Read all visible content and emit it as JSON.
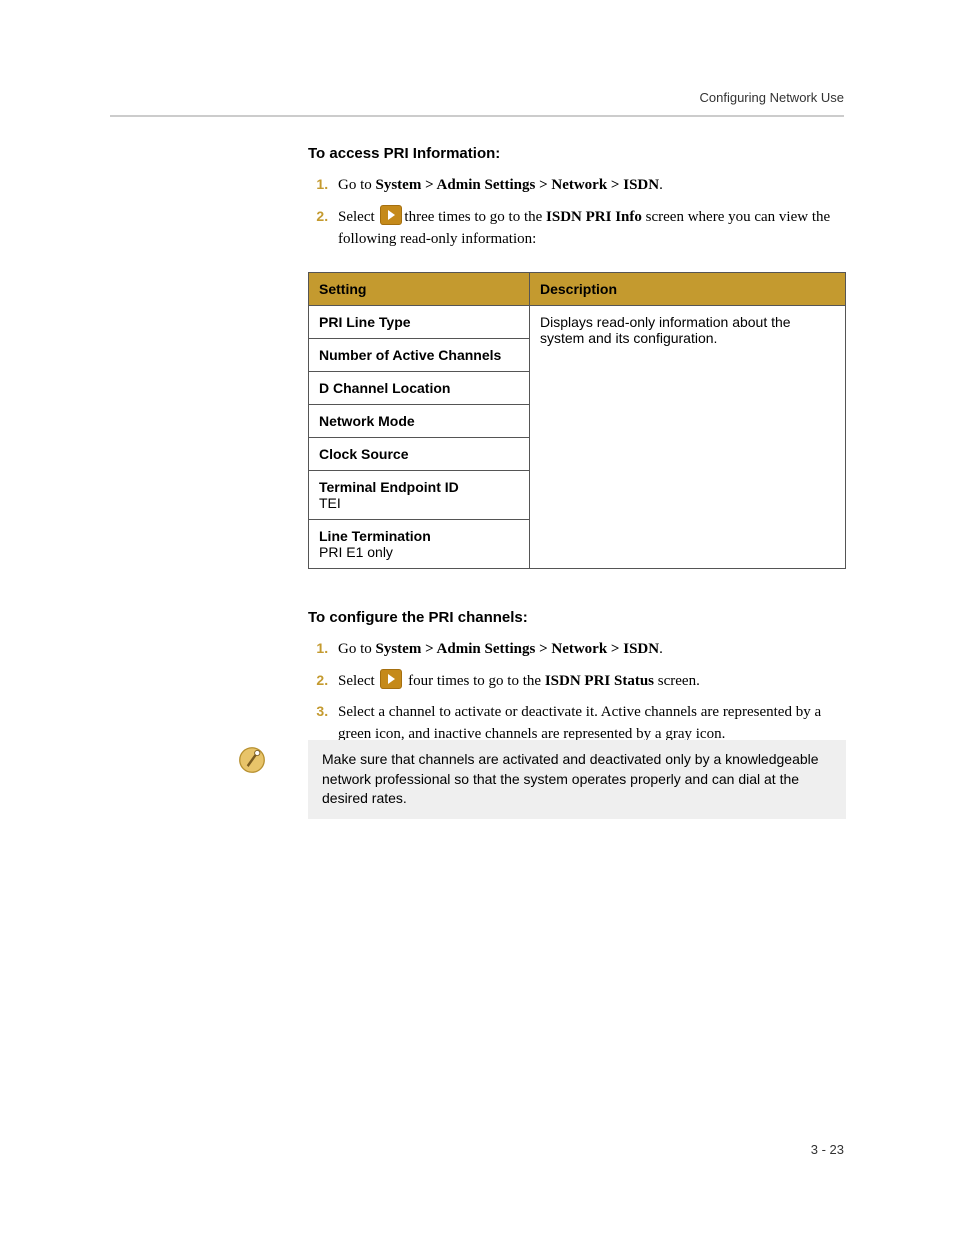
{
  "header": {
    "section_title": "Configuring Network Use"
  },
  "section1": {
    "heading": "To access PRI Information:",
    "steps": [
      {
        "prefix": "Go to ",
        "nav_path": "System > Admin Settings > Network > ISDN",
        "suffix": "."
      },
      {
        "prefix": "Select ",
        "mid": "three times to go to the ",
        "screen": "ISDN PRI Info",
        "suffix": " screen where you can view the following read-only information:"
      }
    ]
  },
  "table": {
    "headers": {
      "setting": "Setting",
      "description": "Description"
    },
    "rows": [
      {
        "label": "PRI Line Type",
        "sub": ""
      },
      {
        "label": "Number of Active Channels",
        "sub": ""
      },
      {
        "label": "D Channel Location",
        "sub": ""
      },
      {
        "label": "Network Mode",
        "sub": ""
      },
      {
        "label": "Clock Source",
        "sub": ""
      },
      {
        "label": "Terminal Endpoint ID",
        "sub": "TEI"
      },
      {
        "label": "Line Termination",
        "sub": "PRI E1 only"
      }
    ],
    "description": "Displays read-only information about the system and its configuration."
  },
  "section2": {
    "heading": "To configure the PRI channels:",
    "steps": [
      {
        "prefix": "Go to ",
        "nav_path": "System > Admin Settings > Network > ISDN",
        "suffix": "."
      },
      {
        "prefix": "Select ",
        "mid": " four times to go to the ",
        "screen": "ISDN PRI Status",
        "suffix": " screen."
      },
      {
        "full": "Select a channel to activate or deactivate it. Active channels are represented by a green icon, and inactive channels are represented by a gray icon."
      }
    ]
  },
  "note": {
    "text": "Make sure that channels are activated and deactivated only by a knowledgeable network professional so that the system operates properly and can dial at the desired rates."
  },
  "footer": {
    "page_number": "3 - 23"
  }
}
